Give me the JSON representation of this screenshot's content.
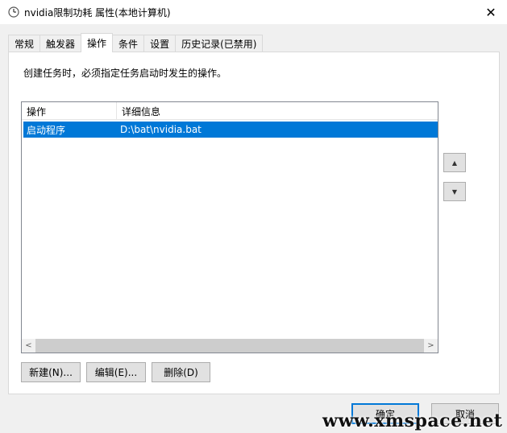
{
  "window": {
    "title": "nvidia限制功耗 属性(本地计算机)",
    "icon": "task-scheduler-clock-icon",
    "close_glyph": "✕"
  },
  "tabs": [
    {
      "label": "常规",
      "active": false
    },
    {
      "label": "触发器",
      "active": false
    },
    {
      "label": "操作",
      "active": true
    },
    {
      "label": "条件",
      "active": false
    },
    {
      "label": "设置",
      "active": false
    },
    {
      "label": "历史记录(已禁用)",
      "active": false
    }
  ],
  "actions_tab": {
    "description": "创建任务时，必须指定任务启动时发生的操作。",
    "columns": [
      "操作",
      "详细信息"
    ],
    "rows": [
      {
        "action": "启动程序",
        "details": "D:\\bat\\nvidia.bat",
        "selected": true
      }
    ],
    "move_up_glyph": "▲",
    "move_down_glyph": "▼",
    "scroll_left_glyph": "<",
    "scroll_right_glyph": ">",
    "buttons": {
      "new": "新建(N)...",
      "edit": "编辑(E)...",
      "delete": "删除(D)"
    }
  },
  "footer": {
    "ok": "确定",
    "cancel": "取消"
  },
  "watermark": "www.xmspace.net",
  "colors": {
    "selection": "#0078d7",
    "panel": "#ffffff",
    "background": "#f0f0f0"
  }
}
